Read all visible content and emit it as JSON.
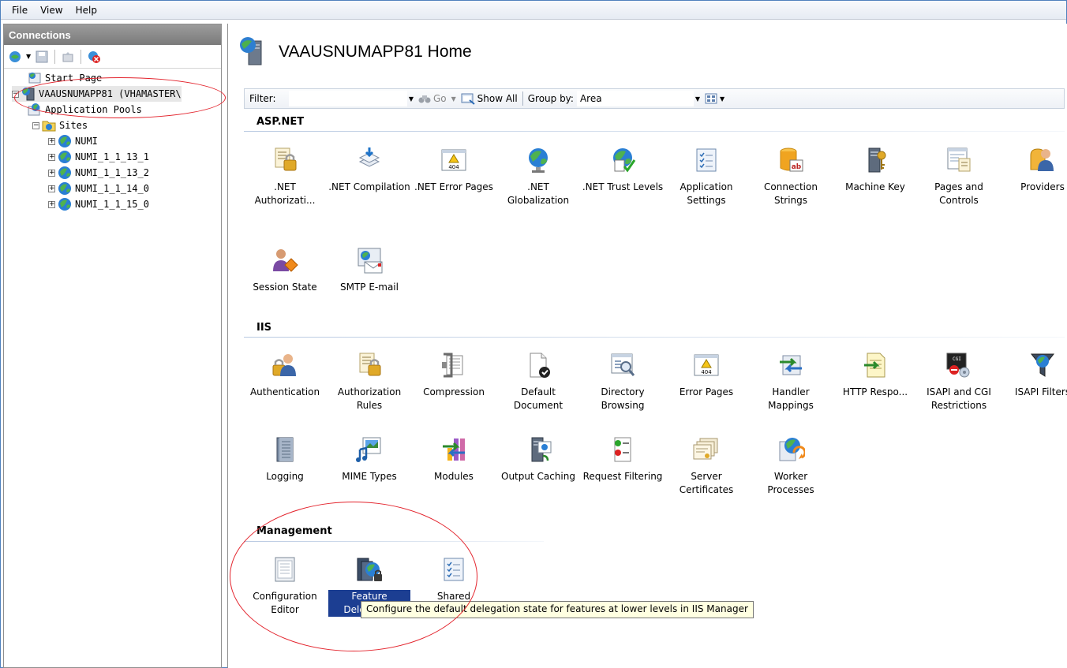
{
  "menu": [
    "File",
    "View",
    "Help"
  ],
  "connections": {
    "title": "Connections",
    "tree": [
      {
        "label": "Start Page",
        "level": 1,
        "expander": "",
        "icon": "start-page-icon"
      },
      {
        "label": "VAAUSNUMAPP81 (VHAMASTER\\",
        "level": 0,
        "expander": "−",
        "icon": "server-icon"
      },
      {
        "label": "Application Pools",
        "level": 1,
        "expander": "",
        "icon": "app-pools-icon"
      },
      {
        "label": "Sites",
        "level": 1,
        "expander": "−",
        "icon": "sites-folder-icon"
      },
      {
        "label": "NUMI",
        "level": 2,
        "expander": "+",
        "icon": "globe-icon"
      },
      {
        "label": "NUMI_1_1_13_1",
        "level": 2,
        "expander": "+",
        "icon": "globe-icon"
      },
      {
        "label": "NUMI_1_1_13_2",
        "level": 2,
        "expander": "+",
        "icon": "globe-icon"
      },
      {
        "label": "NUMI_1_1_14_0",
        "level": 2,
        "expander": "+",
        "icon": "globe-icon"
      },
      {
        "label": "NUMI_1_1_15_0",
        "level": 2,
        "expander": "+",
        "icon": "globe-icon"
      }
    ]
  },
  "main": {
    "title": "VAAUSNUMAPP81 Home",
    "filter_label": "Filter:",
    "filter_value": "",
    "go_label": "Go",
    "show_all_label": "Show All",
    "group_by_label": "Group by:",
    "group_by_value": "Area",
    "sections": [
      {
        "title": "ASP.NET",
        "features": [
          {
            "label": ".NET Authorizati...",
            "icon": "net-authorization-icon"
          },
          {
            "label": ".NET Compilation",
            "icon": "net-compilation-icon"
          },
          {
            "label": ".NET Error Pages",
            "icon": "net-error-pages-icon"
          },
          {
            "label": ".NET Globalization",
            "icon": "net-globalization-icon"
          },
          {
            "label": ".NET Trust Levels",
            "icon": "net-trust-levels-icon"
          },
          {
            "label": "Application Settings",
            "icon": "application-settings-icon"
          },
          {
            "label": "Connection Strings",
            "icon": "connection-strings-icon"
          },
          {
            "label": "Machine Key",
            "icon": "machine-key-icon"
          },
          {
            "label": "Pages and Controls",
            "icon": "pages-and-controls-icon"
          },
          {
            "label": "Providers",
            "icon": "providers-icon"
          },
          {
            "label": "Session State",
            "icon": "session-state-icon"
          },
          {
            "label": "SMTP E-mail",
            "icon": "smtp-email-icon"
          }
        ]
      },
      {
        "title": "IIS",
        "features": [
          {
            "label": "Authentication",
            "icon": "authentication-icon"
          },
          {
            "label": "Authorization Rules",
            "icon": "authorization-rules-icon"
          },
          {
            "label": "Compression",
            "icon": "compression-icon"
          },
          {
            "label": "Default Document",
            "icon": "default-document-icon"
          },
          {
            "label": "Directory Browsing",
            "icon": "directory-browsing-icon"
          },
          {
            "label": "Error Pages",
            "icon": "error-pages-icon"
          },
          {
            "label": "Handler Mappings",
            "icon": "handler-mappings-icon"
          },
          {
            "label": "HTTP Respo...",
            "icon": "http-response-icon"
          },
          {
            "label": "ISAPI and CGI Restrictions",
            "icon": "isapi-cgi-icon"
          },
          {
            "label": "ISAPI Filters",
            "icon": "isapi-filters-icon"
          },
          {
            "label": "Logging",
            "icon": "logging-icon"
          },
          {
            "label": "MIME Types",
            "icon": "mime-types-icon"
          },
          {
            "label": "Modules",
            "icon": "modules-icon"
          },
          {
            "label": "Output Caching",
            "icon": "output-caching-icon"
          },
          {
            "label": "Request Filtering",
            "icon": "request-filtering-icon"
          },
          {
            "label": "Server Certificates",
            "icon": "server-certificates-icon"
          },
          {
            "label": "Worker Processes",
            "icon": "worker-processes-icon"
          }
        ]
      },
      {
        "title": "Management",
        "features": [
          {
            "label": "Configuration Editor",
            "icon": "configuration-editor-icon"
          },
          {
            "label": "Feature Delegation",
            "icon": "feature-delegation-icon"
          },
          {
            "label": "Shared Configuration",
            "icon": "shared-configuration-icon"
          }
        ]
      }
    ],
    "tooltip": "Configure the default delegation state for features at lower levels in IIS Manager"
  },
  "colors": {
    "accent": "#1c3e92",
    "annotation": "#e3232c",
    "tooltip_bg": "#ffffe1"
  }
}
